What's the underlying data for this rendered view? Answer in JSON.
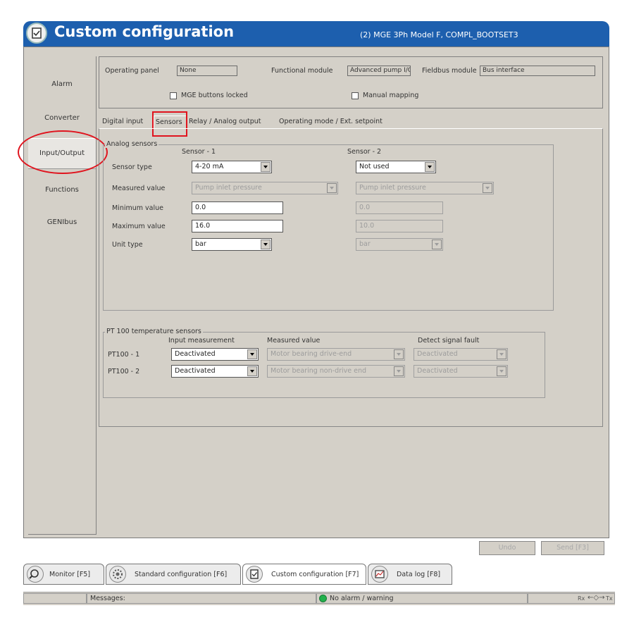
{
  "title": "Custom configuration",
  "device": "(2) MGE 3Ph Model F, COMPL_BOOTSET3",
  "nav": [
    "Alarm",
    "Converter",
    "Input/Output",
    "Functions",
    "GENIbus"
  ],
  "top": {
    "operating_panel_label": "Operating panel",
    "operating_panel_value": "None",
    "functional_module_label": "Functional module",
    "functional_module_value": "Advanced pump I/O",
    "fieldbus_module_label": "Fieldbus module",
    "fieldbus_module_value": "Bus interface",
    "mge_buttons_locked": "MGE buttons locked",
    "manual_mapping": "Manual mapping"
  },
  "tabs": [
    "Digital input",
    "Sensors",
    "Relay / Analog output",
    "Operating mode / Ext. setpoint"
  ],
  "analog": {
    "legend": "Analog sensors",
    "col1": "Sensor - 1",
    "col2": "Sensor - 2",
    "row_labels": [
      "Sensor type",
      "Measured value",
      "Minimum value",
      "Maximum value",
      "Unit type"
    ],
    "sensor1": {
      "sensor_type": "4-20 mA",
      "measured_value": "Pump inlet pressure",
      "min": "0.0",
      "max": "16.0",
      "unit": "bar"
    },
    "sensor2": {
      "sensor_type": "Not used",
      "measured_value": "Pump inlet pressure",
      "min": "0.0",
      "max": "10.0",
      "unit": "bar"
    }
  },
  "pt100": {
    "legend": "PT 100 temperature sensors",
    "h_input": "Input measurement",
    "h_measured": "Measured value",
    "h_detect": "Detect signal fault",
    "rows": [
      {
        "label": "PT100 - 1",
        "input": "Deactivated",
        "measured": "Motor bearing drive-end",
        "detect": "Deactivated"
      },
      {
        "label": "PT100 - 2",
        "input": "Deactivated",
        "measured": "Motor bearing non-drive end",
        "detect": "Deactivated"
      }
    ]
  },
  "buttons": {
    "undo": "Undo",
    "send": "Send [F3]"
  },
  "bottom_tabs": [
    "Monitor [F5]",
    "Standard configuration [F6]",
    "Custom configuration [F7]",
    "Data log [F8]"
  ],
  "status": {
    "messages": "Messages:",
    "alarm": "No alarm / warning",
    "rx_tx_left": "Rx",
    "rx_tx_right": "Tx"
  },
  "colors": {
    "title_bar": "#1d5fae",
    "panel": "#d4d0c8",
    "highlight": "#e0141e",
    "status_ok": "#22b14c"
  }
}
